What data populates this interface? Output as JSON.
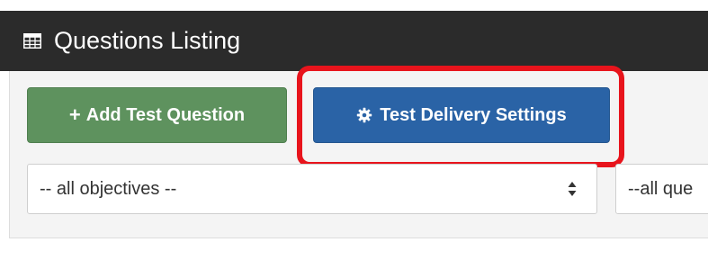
{
  "header": {
    "icon": "table-icon",
    "title": "Questions Listing"
  },
  "toolbar": {
    "add_label": "Add Test Question",
    "add_icon": "plus-icon",
    "settings_label": "Test Delivery Settings",
    "settings_icon": "gear-icon"
  },
  "filters": {
    "objectives_value": "-- all objectives --",
    "questions_value": "--all que"
  },
  "colors": {
    "header_bg": "#2b2b2b",
    "add_button": "#5e925e",
    "settings_button": "#2a63a6",
    "highlight": "#e8141c"
  }
}
